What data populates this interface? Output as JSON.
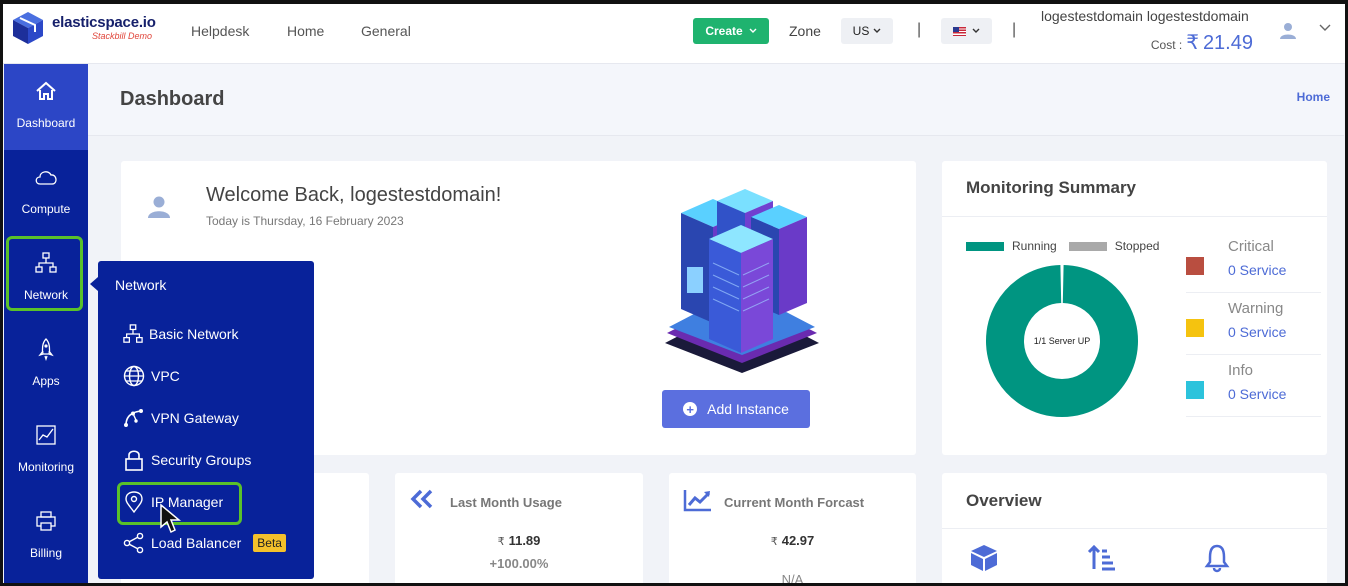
{
  "brand": {
    "name": "elasticspace.io",
    "tagline": "Stackbill Demo"
  },
  "topnav": [
    "Helpdesk",
    "Home",
    "General"
  ],
  "header": {
    "create_label": "Create",
    "zone_label": "Zone",
    "zone_value": "US",
    "separator": "|",
    "user_name": "logestestdomain logestestdomain",
    "cost_label": "Cost :",
    "cost_currency": "₹",
    "cost_value": "21.49"
  },
  "sidebar": {
    "items": [
      {
        "label": "Dashboard",
        "icon": "home-icon",
        "active": true
      },
      {
        "label": "Compute",
        "icon": "cloud-icon"
      },
      {
        "label": "Network",
        "icon": "network-icon"
      },
      {
        "label": "Apps",
        "icon": "rocket-icon"
      },
      {
        "label": "Monitoring",
        "icon": "chart-icon"
      },
      {
        "label": "Billing",
        "icon": "printer-icon"
      }
    ]
  },
  "page": {
    "title": "Dashboard",
    "breadcrumb": "Home"
  },
  "welcome": {
    "title": "Welcome Back, logestestdomain!",
    "date": "Today is Thursday, 16 February 2023",
    "add_button": "Add Instance"
  },
  "monitoring": {
    "title": "Monitoring Summary",
    "legend_running": "Running",
    "legend_stopped": "Stopped",
    "center_label": "1/1 Server UP",
    "running_fraction": 1.0,
    "colors": {
      "running": "#009581",
      "stopped": "#a9a9a9"
    },
    "statuses": [
      {
        "name": "Critical",
        "value": "0 Service",
        "color": "#b94e40"
      },
      {
        "name": "Warning",
        "value": "0 Service",
        "color": "#f5c30f"
      },
      {
        "name": "Info",
        "value": "0 Service",
        "color": "#2cc3dc"
      }
    ]
  },
  "stats": [
    {
      "title": "Last Month Usage",
      "currency": "₹",
      "value": "11.89",
      "sub": "+100.00%",
      "icon": "double-chevron-left-icon"
    },
    {
      "title": "Current Month Forcast",
      "currency": "₹",
      "value": "42.97",
      "sub": "N/A",
      "icon": "trend-chart-icon"
    }
  ],
  "overview": {
    "title": "Overview"
  },
  "network_menu": {
    "title": "Network",
    "items": [
      {
        "label": "Basic Network",
        "icon": "network-icon"
      },
      {
        "label": "VPC",
        "icon": "globe-icon"
      },
      {
        "label": "VPN Gateway",
        "icon": "vpn-icon"
      },
      {
        "label": "Security Groups",
        "icon": "lock-icon"
      },
      {
        "label": "IP Manager",
        "icon": "location-pin-icon"
      },
      {
        "label": "Load Balancer",
        "icon": "share-icon",
        "badge": "Beta"
      }
    ]
  }
}
